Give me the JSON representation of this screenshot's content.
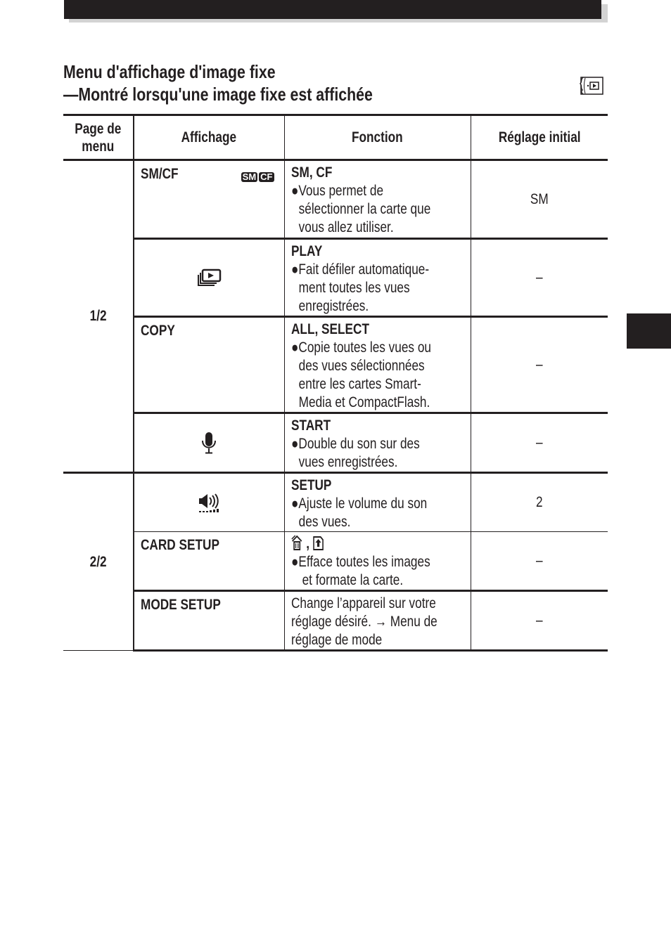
{
  "header": {
    "title_line1": "Menu d'affichage d'image fixe",
    "title_line2": "—Montré lorsqu'une image fixe est affichée",
    "mode_icon": "playback-mode-dial-icon"
  },
  "table": {
    "columns": [
      "Page de menu",
      "Affichage",
      "Fonction",
      "Réglage initial"
    ],
    "column_page_line1": "Page de",
    "column_page_line2": "menu",
    "pages": [
      "1/2",
      "2/2"
    ],
    "rows": [
      {
        "page": "1/2",
        "display_label": "SM/CF",
        "display_icons": [
          "SM",
          "CF"
        ],
        "function_head": "SM, CF",
        "function_lines": [
          "●Vous permet de",
          "sélectionner la carte que",
          "vous allez utiliser."
        ],
        "initial": "SM"
      },
      {
        "page": "1/2",
        "display_label": "",
        "display_icon": "slideshow-icon",
        "function_head": "PLAY",
        "function_lines": [
          "●Fait défiler automatique-",
          "ment toutes les vues",
          "enregistrées."
        ],
        "initial": "–"
      },
      {
        "page": "1/2",
        "display_label": "COPY",
        "function_head": "ALL, SELECT",
        "function_lines": [
          "●Copie toutes les vues ou",
          "des vues sélectionnées",
          "entre les cartes Smart-",
          "Media et CompactFlash."
        ],
        "initial": "–"
      },
      {
        "page": "1/2",
        "display_label": "",
        "display_icon": "microphone-icon",
        "function_head": "START",
        "function_lines": [
          "●Double du son sur des",
          "vues enregistrées."
        ],
        "initial": "–"
      },
      {
        "page": "2/2",
        "display_label": "",
        "display_icon": "volume-icon",
        "function_head": "SETUP",
        "function_lines": [
          "●Ajuste le volume du son",
          "des vues."
        ],
        "initial": "2"
      },
      {
        "page": "2/2",
        "display_label": "CARD SETUP",
        "function_head_icons": [
          "erase-all-icon",
          "format-card-icon"
        ],
        "function_head_separator": ",",
        "function_lines": [
          "●Efface toutes les images",
          "et formate la carte."
        ],
        "initial": "–"
      },
      {
        "page": "2/2",
        "display_label": "MODE SETUP",
        "function_lines": [
          "Change l’appareil sur votre",
          "réglage désiré.",
          "Menu de",
          "réglage de mode"
        ],
        "function_arrow": "→",
        "initial": "–"
      }
    ]
  }
}
